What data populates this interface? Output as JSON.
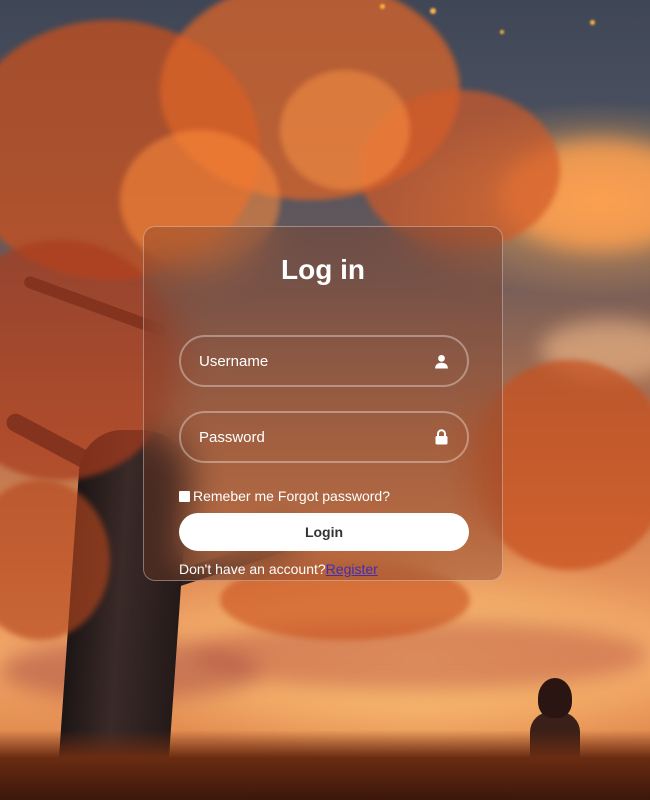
{
  "form": {
    "title": "Log in",
    "username_placeholder": "Username",
    "username_icon": "user-icon",
    "password_placeholder": "Password",
    "password_icon": "lock-icon",
    "remember_label": "Remeber me",
    "forgot_label": "Forgot password?",
    "login_label": "Login",
    "no_account_text": "Don't have an account?",
    "register_label": "Register"
  },
  "colors": {
    "card_border": "#ffffff",
    "button_bg": "#ffffff",
    "button_text": "#333333",
    "link": "#3d2fb8"
  }
}
